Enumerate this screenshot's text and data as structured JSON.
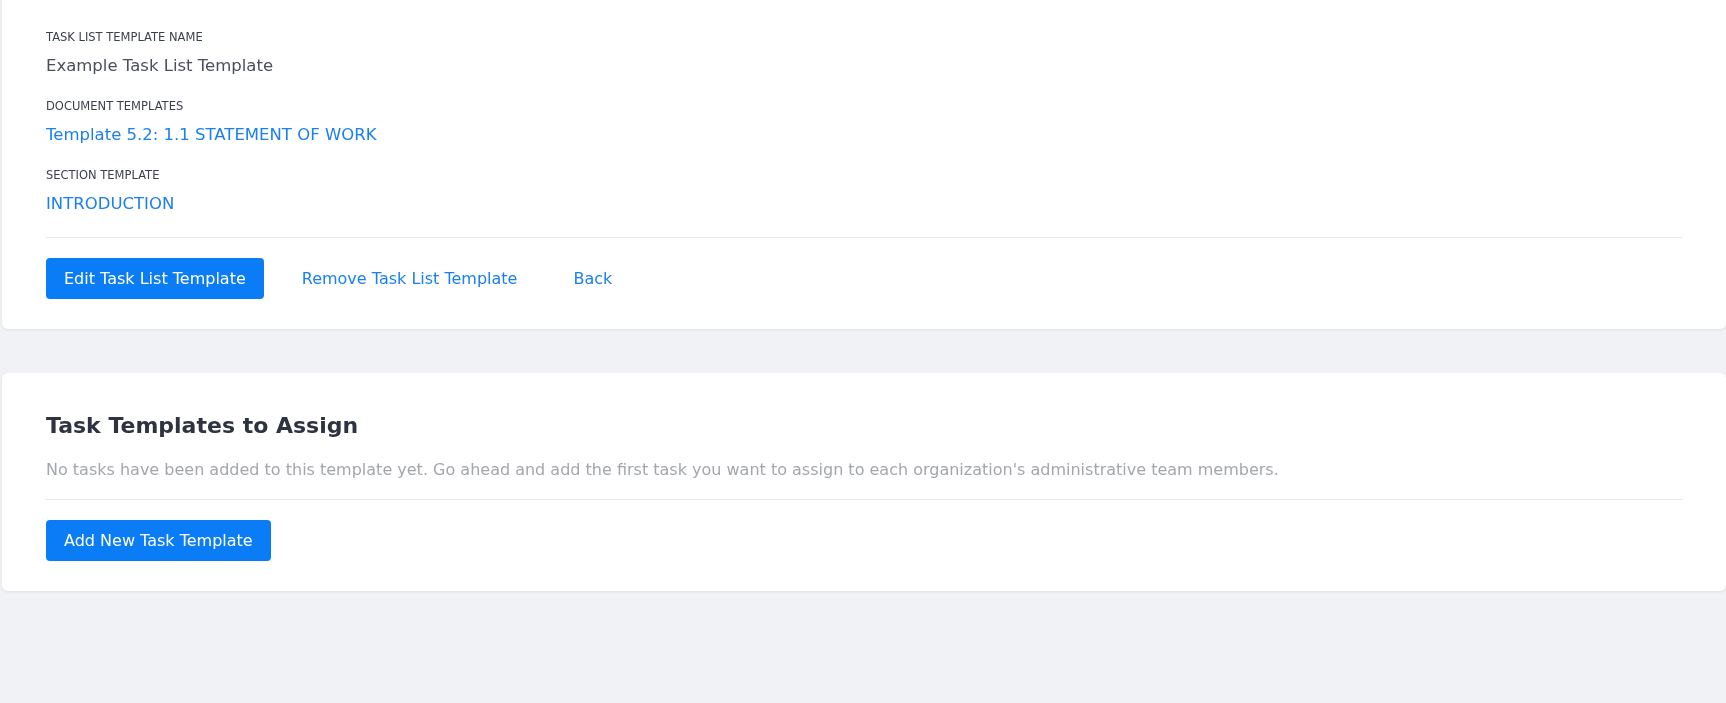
{
  "details": {
    "fields": [
      {
        "label": "TASK LIST TEMPLATE NAME",
        "value": "Example Task List Template",
        "kind": "text"
      },
      {
        "label": "DOCUMENT TEMPLATES",
        "value": "Template 5.2: 1.1 STATEMENT OF WORK",
        "kind": "link"
      },
      {
        "label": "SECTION TEMPLATE",
        "value": "INTRODUCTION",
        "kind": "link"
      }
    ],
    "actions": [
      {
        "label": "Edit Task List Template",
        "kind": "primary"
      },
      {
        "label": "Remove Task List Template",
        "kind": "link"
      },
      {
        "label": "Back",
        "kind": "link"
      }
    ]
  },
  "tasks": {
    "title": "Task Templates to Assign",
    "empty_message": "No tasks have been added to this template yet. Go ahead and add the first task you want to assign to each organization's administrative team members.",
    "actions": [
      {
        "label": "Add New Task Template",
        "kind": "primary"
      }
    ]
  }
}
